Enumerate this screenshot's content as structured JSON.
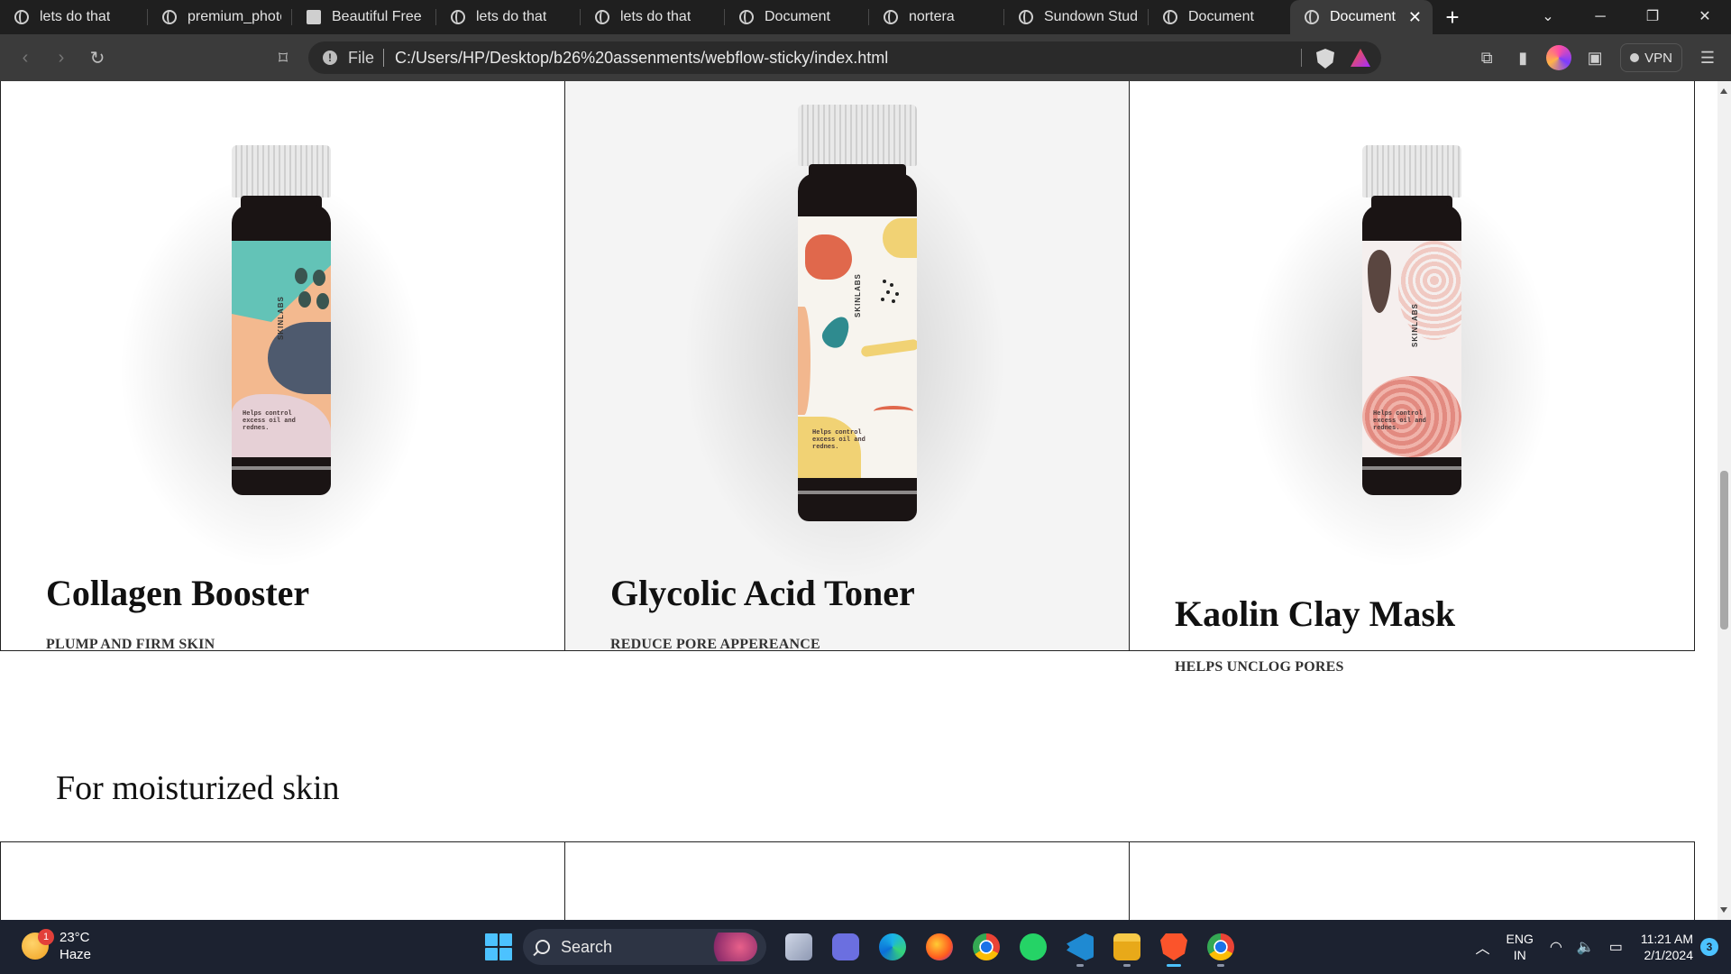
{
  "browser": {
    "tabs": [
      {
        "title": "lets do that",
        "favicon": "globe-icon",
        "active": false
      },
      {
        "title": "premium_photo-",
        "favicon": "globe-icon",
        "active": false
      },
      {
        "title": "Beautiful Free Im",
        "favicon": "image-icon",
        "active": false
      },
      {
        "title": "lets do that",
        "favicon": "globe-icon",
        "active": false
      },
      {
        "title": "lets do that",
        "favicon": "globe-icon",
        "active": false
      },
      {
        "title": "Document",
        "favicon": "globe-icon",
        "active": false
      },
      {
        "title": "nortera",
        "favicon": "globe-icon",
        "active": false
      },
      {
        "title": "Sundown Studio",
        "favicon": "globe-icon",
        "active": false
      },
      {
        "title": "Document",
        "favicon": "globe-icon",
        "active": false
      },
      {
        "title": "Document",
        "favicon": "globe-icon",
        "active": true
      }
    ],
    "new_tab_label": "+",
    "close_label": "✕",
    "file_label": "File",
    "url": "C:/Users/HP/Desktop/b26%20assenments/webflow-sticky/index.html",
    "vpn_label": "VPN"
  },
  "page": {
    "products": [
      {
        "eyebrow": "PLUMP AND FIRM SKIN",
        "name": "Collagen Booster",
        "brand": "SKINLABS",
        "claim": "Helps control excess oil and rednes."
      },
      {
        "eyebrow": "REDUCE PORE APPEREANCE",
        "name": "Glycolic Acid Toner",
        "brand": "SKINLABS",
        "claim": "Helps control excess oil and rednes."
      },
      {
        "eyebrow": "HELPS UNCLOG PORES",
        "name": "Kaolin Clay Mask",
        "brand": "SKINLABS",
        "claim": "Helps control excess oil and rednes."
      }
    ],
    "section_heading": "For moisturized skin"
  },
  "taskbar": {
    "weather": {
      "temp": "23°C",
      "condition": "Haze",
      "badge": "1"
    },
    "search_label": "Search",
    "language": {
      "line1": "ENG",
      "line2": "IN"
    },
    "clock": {
      "time": "11:21 AM",
      "date": "2/1/2024"
    },
    "notifications": "3"
  },
  "colors": {
    "tabbar_bg": "#1f1f1f",
    "toolbar_bg": "#3b3b3b",
    "taskbar_bg": "#1c2230",
    "accent": "#4cc2ff"
  }
}
